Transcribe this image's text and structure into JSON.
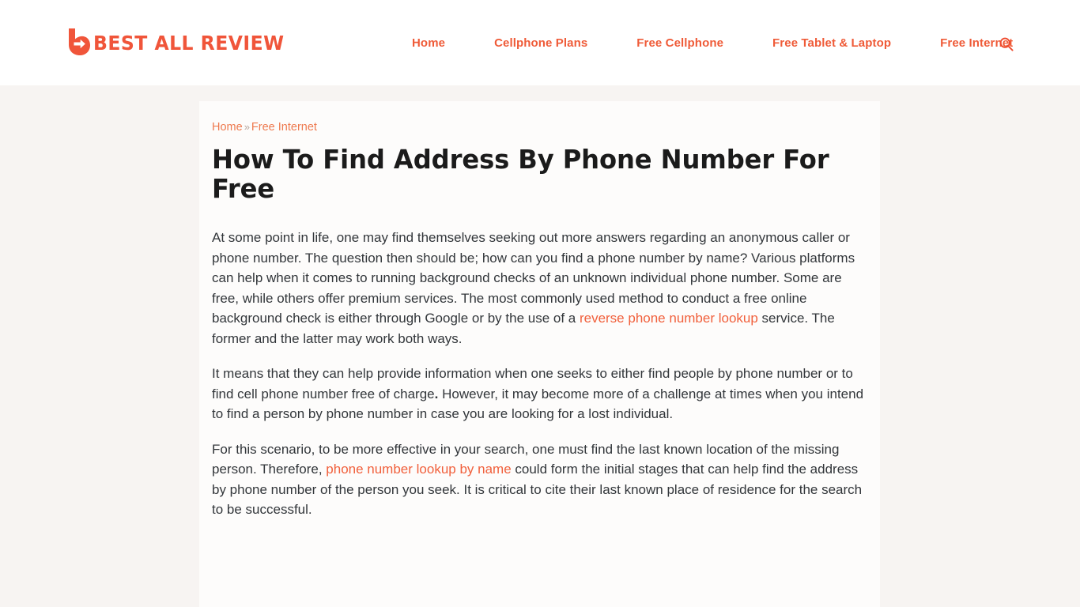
{
  "header": {
    "logo": {
      "mark_icon": "b-arrow-logo-icon",
      "text": "BEST ALL REVIEW",
      "color": "#f0553a"
    },
    "nav": [
      {
        "label": "Home"
      },
      {
        "label": "Cellphone Plans"
      },
      {
        "label": "Free Cellphone"
      },
      {
        "label": "Free Tablet & Laptop"
      },
      {
        "label": "Free Internet"
      }
    ],
    "search": {
      "icon": "search-icon",
      "label": "Search"
    }
  },
  "article": {
    "breadcrumb": {
      "home": "Home",
      "separator": "»",
      "current": "Free Internet"
    },
    "title": "How To Find Address By Phone Number For Free",
    "paragraphs": {
      "p1_part1": "At some point in life, one may find themselves seeking out more answers regarding an anonymous caller or phone number. The question then should be; how can you find a phone number by name? Various platforms can help when it comes to running background checks of an unknown individual phone number. Some are free, while others offer premium services. The most commonly used method to conduct a free online background check is either through Google or by the use of a ",
      "p1_link": "reverse phone number lookup",
      "p1_part2": " service. The former and the latter may work both ways.",
      "p2_part1": "It means that they can help provide information when one seeks to either find people by phone number or to find cell phone number free of charge",
      "p2_bold": ".",
      "p2_part2": " However, it may become more of a challenge at times when you intend to find a person by phone number in case you are looking for a lost individual.",
      "p3_part1": "For this scenario, to be more effective in your search, one must find the last known location of the missing person. Therefore, ",
      "p3_link": "phone number lookup by name",
      "p3_part2": " could form the initial stages that can help find the address by phone number of the person you seek. It is critical to cite their last known place of residence for the search to be successful."
    }
  },
  "theme": {
    "brand_orange": "#ef5b38",
    "link_orange": "#f1603c",
    "page_background": "#f7f4f2",
    "card_background": "#fdfcfb",
    "body_text": "#32363a"
  }
}
